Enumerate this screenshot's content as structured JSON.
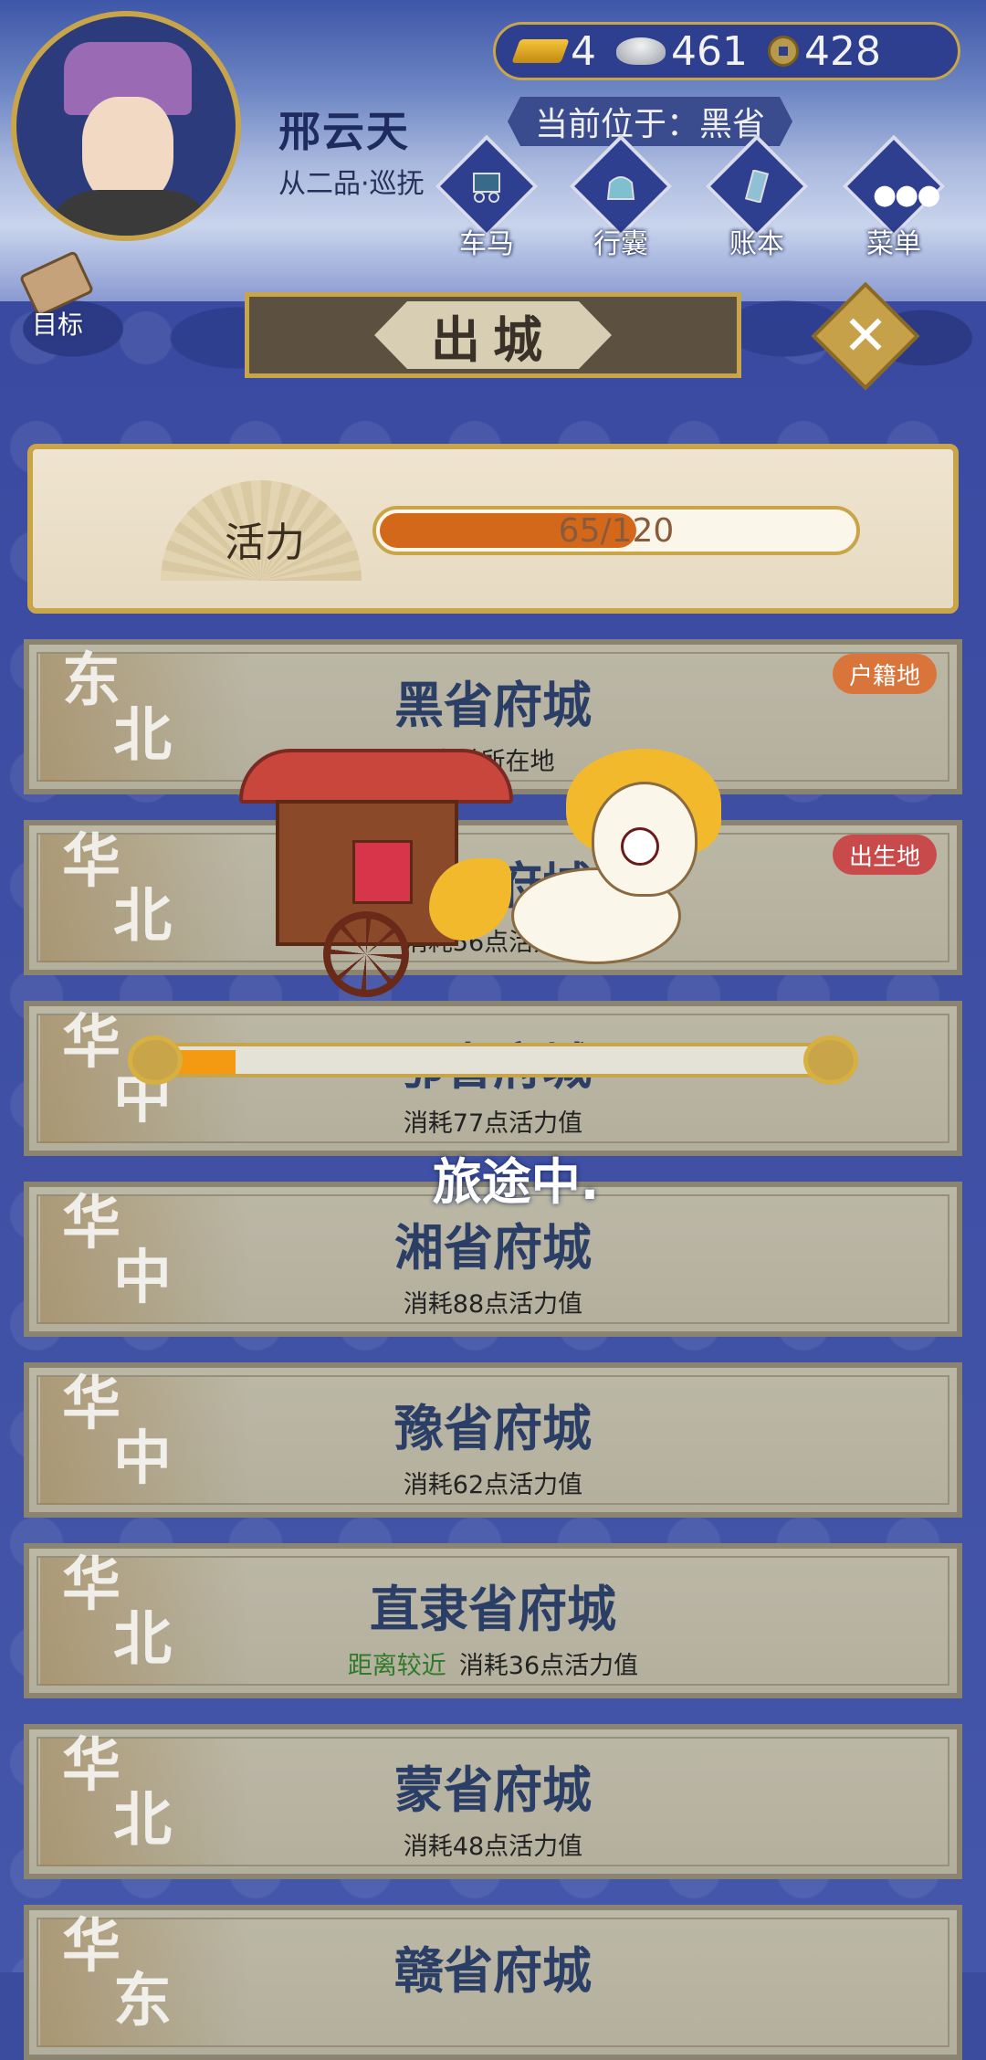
{
  "player": {
    "name": "邢云天",
    "rank": "从二品·巡抚"
  },
  "currency": {
    "gold": "4",
    "silver": "461",
    "coins": "428"
  },
  "location": "当前位于：黑省",
  "nav": [
    {
      "label": "车马",
      "icon": "carriage-icon"
    },
    {
      "label": "行囊",
      "icon": "bag-icon"
    },
    {
      "label": "账本",
      "icon": "ledger-icon"
    },
    {
      "label": "菜单",
      "icon": "menu-icon"
    }
  ],
  "goal": {
    "label": "目标",
    "icon": "scroll-icon"
  },
  "banner": {
    "title": "出城"
  },
  "stamina": {
    "label": "活力",
    "text": "65/120",
    "current": 65,
    "max": 120,
    "fill_color": "#d4681a"
  },
  "cities": [
    {
      "region": [
        "东",
        "北"
      ],
      "name": "黑省府城",
      "cost": "当前所在地",
      "near": "",
      "tag": "户籍地",
      "tag_color": "#d9753a"
    },
    {
      "region": [
        "华",
        "北"
      ],
      "name": "晋省府城",
      "cost": "消耗56点活力值",
      "near": "",
      "tag": "出生地",
      "tag_color": "#c94a4a"
    },
    {
      "region": [
        "华",
        "中"
      ],
      "name": "鄂省府城",
      "cost": "消耗77点活力值",
      "near": "",
      "tag": "",
      "tag_color": ""
    },
    {
      "region": [
        "华",
        "中"
      ],
      "name": "湘省府城",
      "cost": "消耗88点活力值",
      "near": "",
      "tag": "",
      "tag_color": ""
    },
    {
      "region": [
        "华",
        "中"
      ],
      "name": "豫省府城",
      "cost": "消耗62点活力值",
      "near": "",
      "tag": "",
      "tag_color": ""
    },
    {
      "region": [
        "华",
        "北"
      ],
      "name": "直隶省府城",
      "cost": "消耗36点活力值",
      "near": "距离较近",
      "tag": "",
      "tag_color": ""
    },
    {
      "region": [
        "华",
        "北"
      ],
      "name": "蒙省府城",
      "cost": "消耗48点活力值",
      "near": "",
      "tag": "",
      "tag_color": ""
    },
    {
      "region": [
        "华",
        "东"
      ],
      "name": "赣省府城",
      "cost": "",
      "near": "",
      "tag": "",
      "tag_color": ""
    }
  ],
  "travel": {
    "status": "旅途中.",
    "progress": 0.1
  }
}
